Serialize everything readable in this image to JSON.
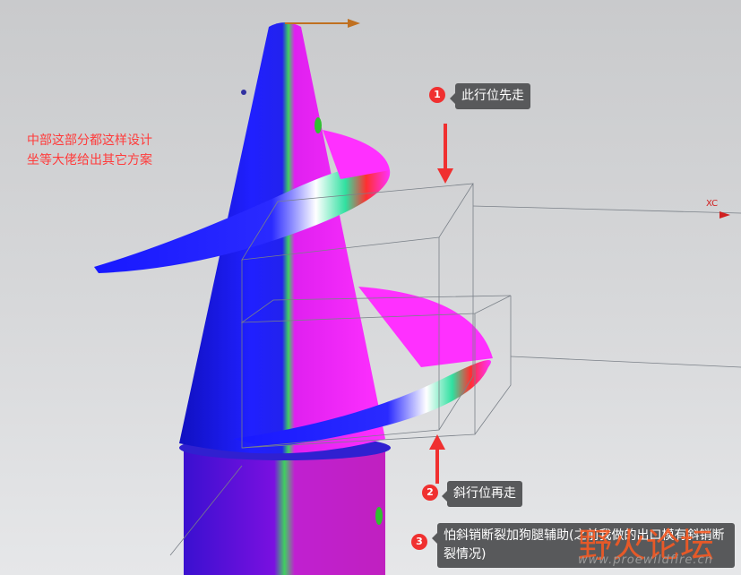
{
  "note": {
    "line1": "中部这部分都这样设计",
    "line2": "坐等大佬给出其它方案"
  },
  "axis_label": "XC",
  "callouts": [
    {
      "number": "1",
      "text": "此行位先走"
    },
    {
      "number": "2",
      "text": "斜行位再走"
    },
    {
      "number": "3",
      "text": "怕斜销断裂加狗腿辅助(之前我做的出口模有斜销断裂情况)"
    }
  ],
  "watermark": {
    "logo": "野火论坛",
    "url": "www.proewildfire.cn"
  },
  "colors": {
    "note": "#ff3b3b",
    "callout_bg": "#58595b",
    "badge": "#f03030",
    "model_blue": "#1a1aff",
    "model_magenta": "#ff20ff"
  }
}
